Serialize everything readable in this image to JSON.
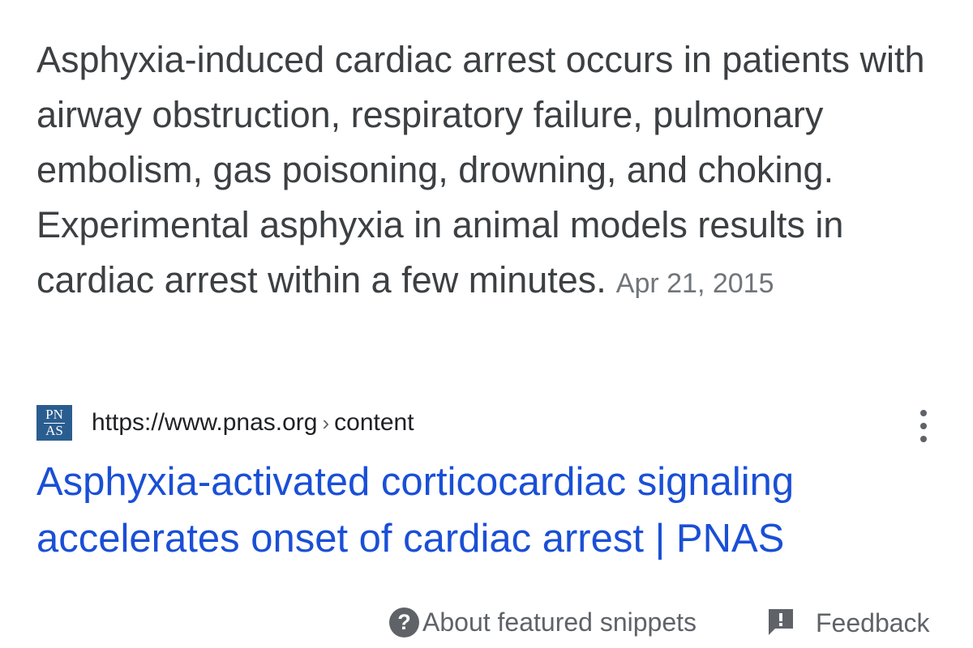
{
  "snippet": {
    "text": "Asphyxia-induced cardiac arrest occurs in patients with airway obstruction, respiratory failure, pulmonary embolism, gas poisoning, drowning, and choking. Experimental asphyxia in animal models results in cardiac arrest within a few minutes.",
    "date": "Apr 21, 2015"
  },
  "source": {
    "favicon_line1": "PN",
    "favicon_line2": "AS",
    "url": "https://www.pnas.org",
    "separator": "›",
    "breadcrumb": "content",
    "more_icon": "more-vert-icon"
  },
  "result": {
    "title": "Asphyxia-activated corticocardiac signaling accelerates onset of cardiac arrest | PNAS"
  },
  "footer": {
    "help_icon": "help-circle-icon",
    "help_glyph": "?",
    "about_label": "About featured snippets",
    "feedback_icon": "feedback-icon",
    "feedback_label": "Feedback"
  },
  "colors": {
    "body_text": "#3c4043",
    "date_text": "#70757a",
    "link": "#1a4fd6",
    "icon_gray": "#5f6368",
    "favicon_bg": "#2a5d8f"
  }
}
